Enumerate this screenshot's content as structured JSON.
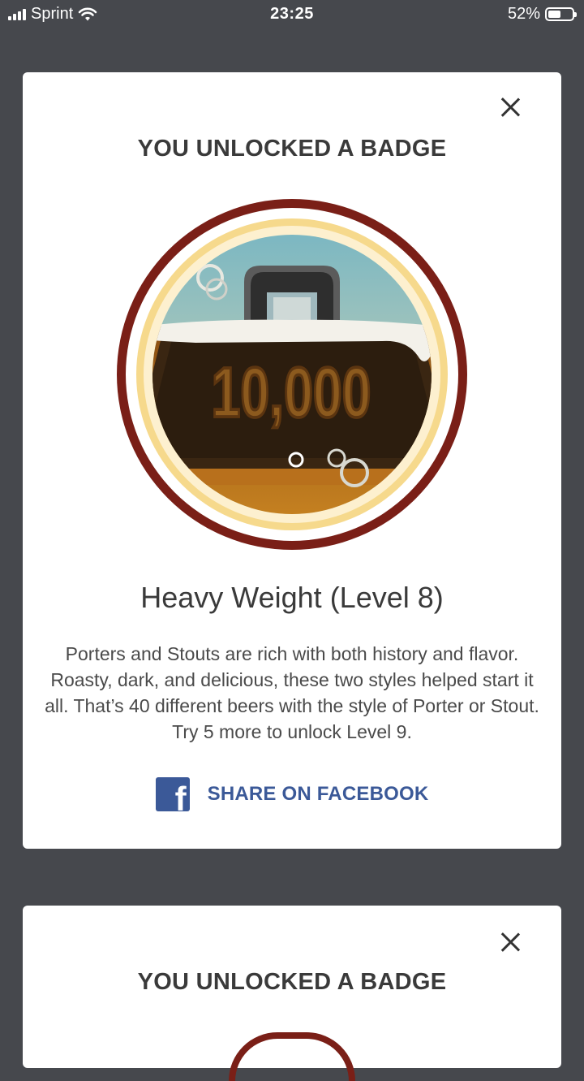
{
  "status_bar": {
    "carrier": "Sprint",
    "time": "23:25",
    "battery_percent": "52%",
    "battery_level": 0.52
  },
  "cards": [
    {
      "heading": "YOU UNLOCKED A BADGE",
      "badge": {
        "number_text": "10,000",
        "name": "Heavy Weight (Level 8)",
        "description": "Porters and Stouts are rich with both history and flavor. Roasty, dark, and delicious, these two styles helped start it all. That’s 40 different beers with the style of Porter or Stout. Try 5 more to unlock Level 9."
      },
      "share_label": "SHARE ON FACEBOOK",
      "facebook_icon_letter": "f"
    },
    {
      "heading": "YOU UNLOCKED A BADGE"
    }
  ],
  "colors": {
    "background": "#46484d",
    "card": "#ffffff",
    "facebook_blue": "#3b5998",
    "badge_ring": "#7a1f17"
  },
  "icons": [
    "signal-icon",
    "wifi-icon",
    "battery-icon",
    "close-icon",
    "facebook-icon"
  ]
}
